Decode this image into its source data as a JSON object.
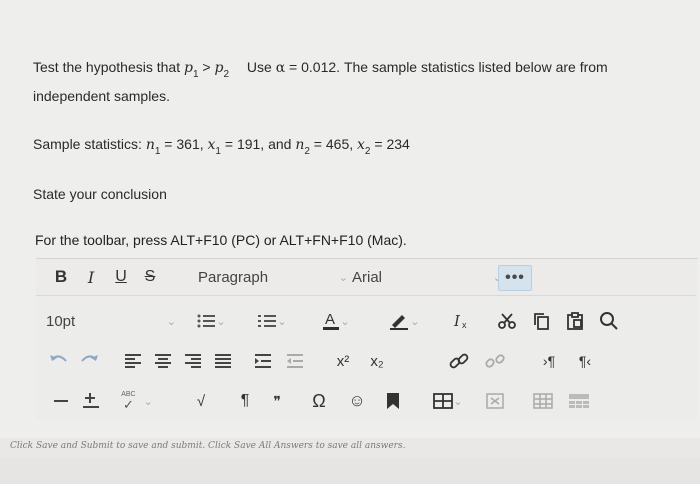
{
  "question": {
    "line1_pre": "Test the hypothesis that ",
    "p": "p",
    "sub1": "1",
    "gt": " > ",
    "sub2": "2",
    "line1_post": "Use ",
    "alpha": "α",
    "line1_alpha_val": " = 0.012. The sample statistics listed below are from",
    "line2": "independent samples.",
    "stats_label": "Sample statistics: ",
    "n": "n",
    "x": "x",
    "eq_n1": " = 361, ",
    "eq_x1": " = 191, and ",
    "eq_n2": " = 465, ",
    "eq_x2": " = 234",
    "conclusion": "State your conclusion"
  },
  "editor": {
    "hint": "For the toolbar, press ALT+F10 (PC) or ALT+FN+F10 (Mac).",
    "bold": "B",
    "italic": "I",
    "underline": "U",
    "strike": "S",
    "block_format": "Paragraph",
    "font_family": "Arial",
    "font_size": "10pt",
    "more": "•••",
    "chevron": "⌄",
    "superscript": "x²",
    "subscript": "x₂",
    "omega": "Ω",
    "pilcrow": "¶",
    "quote": "❞",
    "ltr": "›¶",
    "rtl": "¶‹",
    "spell_label": "ABC"
  },
  "footer": {
    "note": "Click Save and Submit to save and submit. Click Save All Answers to save all answers."
  }
}
